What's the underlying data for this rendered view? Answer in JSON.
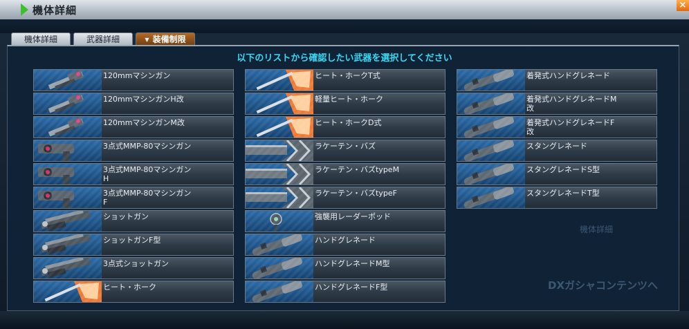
{
  "window": {
    "title": "機体詳細",
    "close_icon": "×"
  },
  "tabs": [
    {
      "label": "機体詳細",
      "active": false
    },
    {
      "label": "武器詳細",
      "active": false
    },
    {
      "label": "装備制限",
      "active": true
    }
  ],
  "instruction": "以下のリストから確認したい武器を選択してください",
  "weapons": [
    {
      "label": "120mmマシンガン",
      "icon": "machine-gun-icon"
    },
    {
      "label": "120mmマシンガンH改",
      "icon": "machine-gun-icon"
    },
    {
      "label": "120mmマシンガンM改",
      "icon": "machine-gun-icon"
    },
    {
      "label": "3点式MMP-80マシンガン",
      "icon": "mmp80-icon"
    },
    {
      "label": "3点式MMP-80マシンガン\nH",
      "icon": "mmp80-icon"
    },
    {
      "label": "3点式MMP-80マシンガン\nF",
      "icon": "mmp80-icon"
    },
    {
      "label": "ショットガン",
      "icon": "shotgun-icon"
    },
    {
      "label": "ショットガンF型",
      "icon": "shotgun-icon"
    },
    {
      "label": "3点式ショットガン",
      "icon": "shotgun-icon"
    },
    {
      "label": "ヒート・ホーク",
      "icon": "heat-hawk-icon"
    },
    {
      "label": "ヒート・ホークT式",
      "icon": "heat-hawk-icon"
    },
    {
      "label": "軽量ヒート・ホーク",
      "icon": "heat-hawk-icon"
    },
    {
      "label": "ヒート・ホークD式",
      "icon": "heat-hawk-icon"
    },
    {
      "label": "ラケーテン・バズ",
      "icon": "bazooka-icon"
    },
    {
      "label": "ラケーテン・バズtypeM",
      "icon": "bazooka-icon"
    },
    {
      "label": "ラケーテン・バズtypeF",
      "icon": "bazooka-icon"
    },
    {
      "label": "強襲用レーダーポッド",
      "icon": "radar-pod-icon"
    },
    {
      "label": "ハンドグレネード",
      "icon": "grenade-icon"
    },
    {
      "label": "ハンドグレネードM型",
      "icon": "grenade-icon"
    },
    {
      "label": "ハンドグレネードF型",
      "icon": "grenade-icon"
    },
    {
      "label": "着発式ハンドグレネード",
      "icon": "grenade-icon"
    },
    {
      "label": "着発式ハンドグレネードM\n改",
      "icon": "grenade-icon"
    },
    {
      "label": "着発式ハンドグレネードF\n改",
      "icon": "grenade-icon"
    },
    {
      "label": "スタングレネード",
      "icon": "grenade-icon"
    },
    {
      "label": "スタングレネードS型",
      "icon": "grenade-icon"
    },
    {
      "label": "スタングレネードT型",
      "icon": "grenade-icon"
    }
  ],
  "background": {
    "faded_button_1": "機体詳細",
    "faded_button_2": "DXガシャコンテンツへ"
  }
}
